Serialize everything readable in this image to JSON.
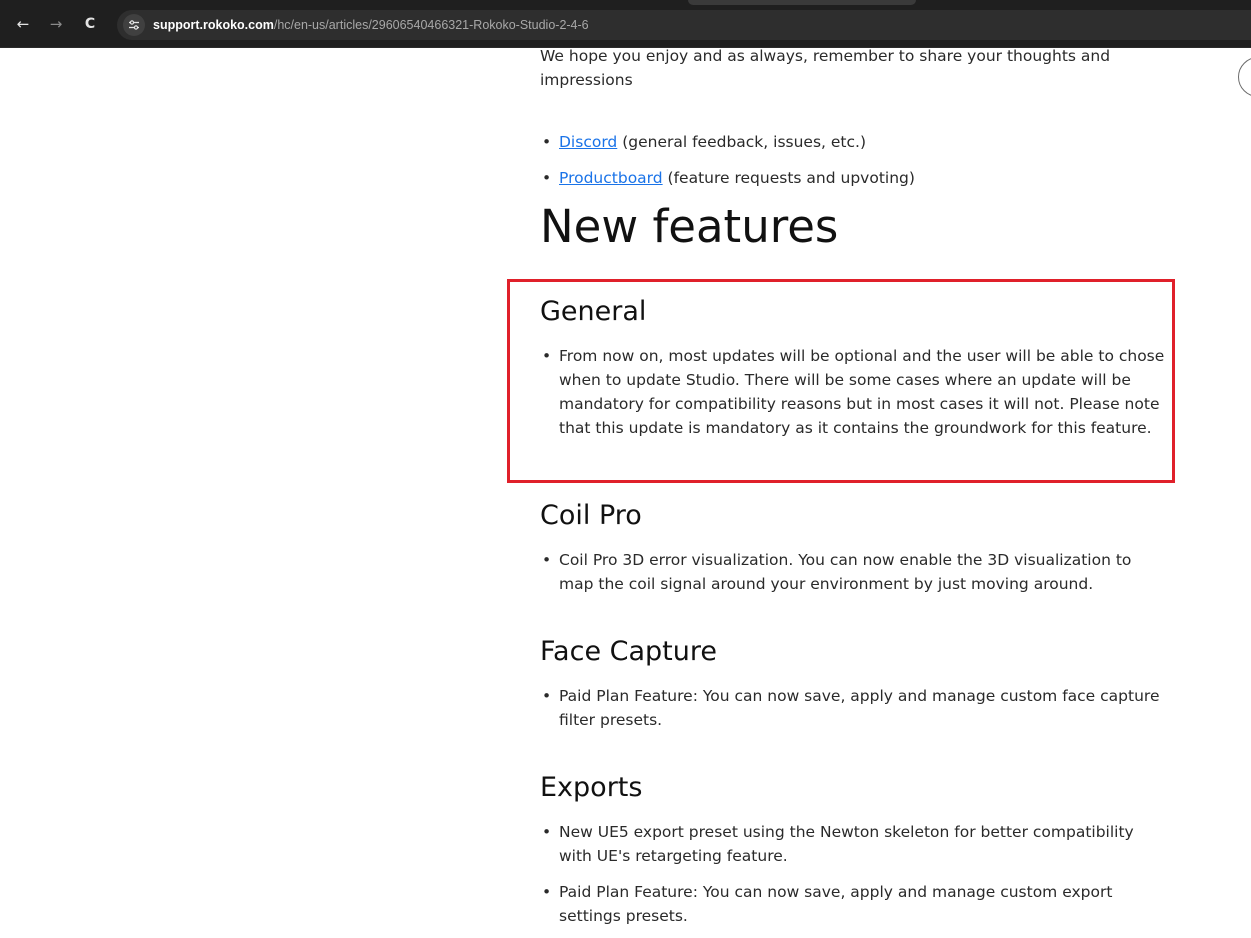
{
  "browser": {
    "nav_back": "←",
    "nav_forward": "→",
    "nav_reload": "C",
    "site_info_icon": "tune-icon",
    "url_host": "support.rokoko.com",
    "url_path": "/hc/en-us/articles/29606540466321-Rokoko-Studio-2-4-6"
  },
  "article": {
    "intro": "We hope you enjoy and as always, remember to share your thoughts and impressions",
    "feedback": [
      {
        "link": "Discord",
        "text": " (general feedback, issues, etc.)"
      },
      {
        "link": "Productboard",
        "text": " (feature requests and upvoting)"
      }
    ],
    "heading": "New features",
    "sections": [
      {
        "title": "General",
        "items": [
          "From now on, most updates will be optional and the user will be able to chose when to update Studio. There will be some cases where an update will be mandatory for compatibility reasons but in most cases it will not. Please note that this update is mandatory as it contains the groundwork for this feature."
        ]
      },
      {
        "title": "Coil Pro",
        "items": [
          "Coil Pro 3D error visualization. You can now enable the 3D visualization to map the coil signal around your environment by just moving around."
        ]
      },
      {
        "title": "Face Capture",
        "items": [
          "Paid Plan Feature: You can now save, apply and manage custom face capture filter presets."
        ]
      },
      {
        "title": "Exports",
        "items": [
          "New UE5 export preset using the Newton skeleton for better compatibility with UE's retargeting feature.",
          "Paid Plan Feature: You can now save, apply and manage custom export settings presets."
        ]
      }
    ]
  },
  "colors": {
    "link": "#1a73e8",
    "highlight": "#e0202a",
    "browser_bar": "#1f1f1f"
  }
}
